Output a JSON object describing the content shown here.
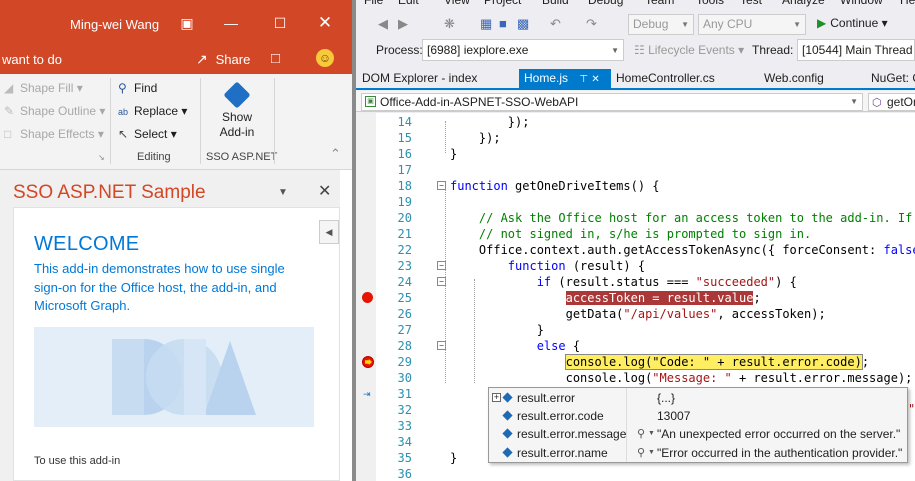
{
  "powerpoint": {
    "title_user": "Ming-wei Wang",
    "tell_me": "want to do",
    "share_label": "Share",
    "ribbon": {
      "shape_fill": "Shape Fill",
      "shape_outline": "Shape Outline",
      "shape_effects": "Shape Effects",
      "find": "Find",
      "replace": "Replace",
      "select": "Select",
      "editing_group": "Editing",
      "show_addin_line1": "Show",
      "show_addin_line2": "Add-in",
      "sso_group": "SSO ASP.NET"
    },
    "taskpane": {
      "title": "SSO ASP.NET Sample",
      "welcome": "WELCOME",
      "description": "This add-in demonstrates how to use single sign-on for the Office host, the add-in, and Microsoft Graph.",
      "use_addin": "To use this add-in"
    },
    "colors": {
      "accent": "#d24726",
      "link_blue": "#0078d7"
    }
  },
  "vs": {
    "menu": [
      "File",
      "Edit",
      "View",
      "Project",
      "Build",
      "Debug",
      "Team",
      "Tools",
      "Test",
      "Analyze",
      "Window",
      "He"
    ],
    "toolbar": {
      "config": "Debug",
      "platform": "Any CPU",
      "continue": "Continue"
    },
    "process": {
      "process_label": "Process:",
      "process_value": "[6988] iexplore.exe",
      "lifecycle": "Lifecycle Events",
      "thread_label": "Thread:",
      "thread_value": "[10544] Main Thread"
    },
    "tabs": [
      {
        "label": "DOM Explorer - index"
      },
      {
        "label": "Home.js"
      },
      {
        "label": "HomeController.cs"
      },
      {
        "label": "Web.config"
      },
      {
        "label": "NuGet: O"
      }
    ],
    "nav": {
      "project": "Office-Add-in-ASPNET-SSO-WebAPI",
      "member": "getOn"
    },
    "code": [
      {
        "ln": "14",
        "text": "        });"
      },
      {
        "ln": "15",
        "text": "    });"
      },
      {
        "ln": "16",
        "text": "}"
      },
      {
        "ln": "17",
        "text": ""
      },
      {
        "ln": "18",
        "kw": "function",
        "text": " getOneDriveItems() {"
      },
      {
        "ln": "19",
        "text": ""
      },
      {
        "ln": "20",
        "cm": "    // Ask the Office host for an access token to the add-in. If th"
      },
      {
        "ln": "21",
        "cm": "    // not signed in, s/he is prompted to sign in."
      },
      {
        "ln": "22",
        "text": "    Office.context.auth.getAccessTokenAsync({ forceConsent: ",
        "kw2": "false",
        "tail": " }"
      },
      {
        "ln": "23",
        "pre": "        ",
        "kw": "function",
        "text": " (result) {"
      },
      {
        "ln": "24",
        "pre": "            ",
        "kw": "if",
        "text": " (result.status === ",
        "str": "\"succeeded\"",
        "tail": ") {"
      },
      {
        "ln": "25",
        "pre": "                ",
        "hl": "accessToken = result.value",
        "tail": ";"
      },
      {
        "ln": "26",
        "pre": "                getData(",
        "str": "\"/api/values\"",
        "tail": ", accessToken);"
      },
      {
        "ln": "27",
        "text": "            }"
      },
      {
        "ln": "28",
        "pre": "            ",
        "kw": "else",
        "text": " {"
      },
      {
        "ln": "29",
        "pre": "                ",
        "cur": "console.log(\"Code: \" + result.error.code)",
        "tail": ";"
      },
      {
        "ln": "30",
        "pre": "                console.log(",
        "str": "\"Message: \"",
        "tail": " + result.error.message);"
      },
      {
        "ln": "31",
        "text": ""
      },
      {
        "ln": "32",
        "text": ""
      },
      {
        "ln": "33",
        "text": ""
      },
      {
        "ln": "34",
        "text": ""
      },
      {
        "ln": "35",
        "text": "}"
      },
      {
        "ln": "36",
        "text": ""
      }
    ],
    "line32_tail": "\"",
    "datatip": [
      {
        "name": "result.error",
        "value": "{...}",
        "expandable": true,
        "magnifier": false
      },
      {
        "name": "result.error.code",
        "value": "13007",
        "expandable": false,
        "magnifier": false
      },
      {
        "name": "result.error.message",
        "value": "\"An unexpected error occurred on the server.\"",
        "expandable": false,
        "magnifier": true
      },
      {
        "name": "result.error.name",
        "value": "\"Error occurred in the authentication provider.\"",
        "expandable": false,
        "magnifier": true
      }
    ],
    "colors": {
      "tab_active": "#007acc",
      "breakpoint": "#e51400",
      "current_line": "#ffee62"
    }
  }
}
